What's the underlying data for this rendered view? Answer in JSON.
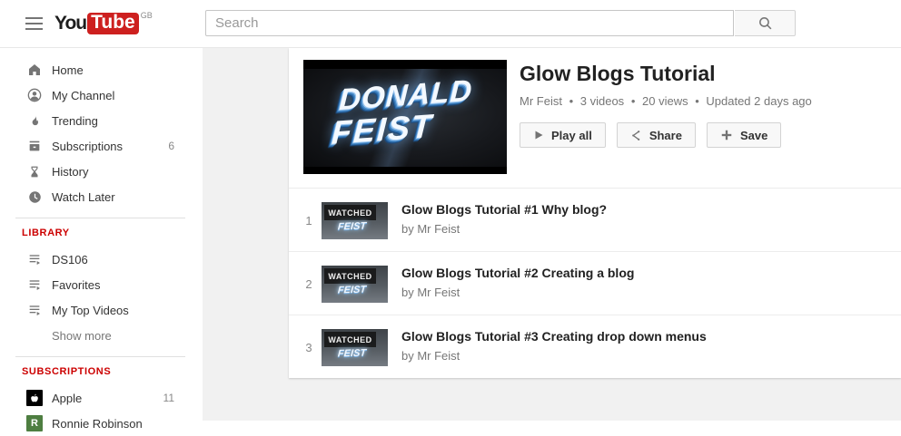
{
  "header": {
    "logo": {
      "part1": "You",
      "part2": "Tube",
      "region": "GB"
    },
    "search": {
      "placeholder": "Search"
    }
  },
  "sidebar": {
    "items": [
      {
        "label": "Home"
      },
      {
        "label": "My Channel"
      },
      {
        "label": "Trending"
      },
      {
        "label": "Subscriptions",
        "count": "6"
      },
      {
        "label": "History"
      },
      {
        "label": "Watch Later"
      }
    ],
    "library": {
      "title": "LIBRARY",
      "items": [
        {
          "label": "DS106"
        },
        {
          "label": "Favorites"
        },
        {
          "label": "My Top Videos"
        }
      ],
      "show_more": "Show more"
    },
    "subscriptions": {
      "title": "SUBSCRIPTIONS",
      "items": [
        {
          "label": "Apple",
          "count": "11",
          "avatar_color": "#000000"
        },
        {
          "label": "Ronnie Robinson",
          "initial": "R",
          "avatar_color": "#4e7e41"
        }
      ]
    }
  },
  "playlist": {
    "title": "Glow Blogs Tutorial",
    "meta": {
      "channel": "Mr Feist",
      "sep": "•",
      "videos_count": "3 videos",
      "views": "20 views",
      "updated": "Updated 2 days ago"
    },
    "thumbnail": {
      "line1": "DONALD",
      "line2": "FEIST"
    },
    "buttons": {
      "play_all": "Play all",
      "share": "Share",
      "save": "Save"
    }
  },
  "videos": [
    {
      "index": "1",
      "title": "Glow Blogs Tutorial #1 Why blog?",
      "byline": "by Mr Feist",
      "watched": "WATCHED",
      "thumb_text": "FEIST"
    },
    {
      "index": "2",
      "title": "Glow Blogs Tutorial #2 Creating a blog",
      "byline": "by Mr Feist",
      "watched": "WATCHED",
      "thumb_text": "FEIST"
    },
    {
      "index": "3",
      "title": "Glow Blogs Tutorial #3 Creating drop down menus",
      "byline": "by Mr Feist",
      "watched": "WATCHED",
      "thumb_text": "FEIST"
    }
  ],
  "colors": {
    "brand_red": "#cd201f",
    "section_title_red": "#cc0000",
    "background_gray": "#f1f1f1",
    "text_dark": "#212121",
    "text_gray": "#767676",
    "icon_gray": "#757575"
  }
}
